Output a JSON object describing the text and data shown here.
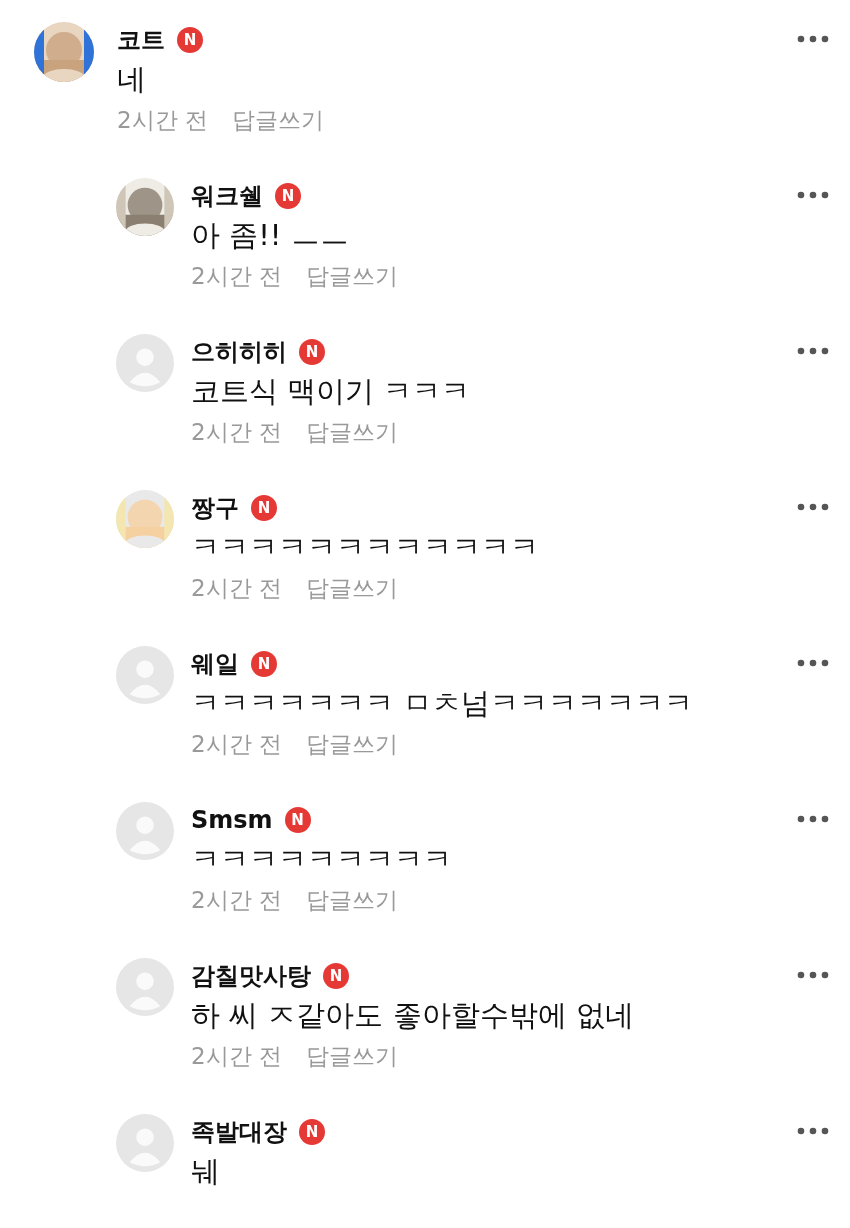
{
  "comments": [
    {
      "name": "코트",
      "badge": "N",
      "text": "네",
      "time": "2시간 전",
      "reply_label": "답글쓰기",
      "children": [
        {
          "name": "워크쉘",
          "badge": "N",
          "text": "아 좀!! ㅡㅡ",
          "time": "2시간 전",
          "reply_label": "답글쓰기"
        },
        {
          "name": "으히히히",
          "badge": "N",
          "avatar": {
            "kind": "default"
          },
          "text": "코트식 맥이기 ㅋㅋㅋ",
          "time": "2시간 전",
          "reply_label": "답글쓰기"
        },
        {
          "name": "짱구",
          "badge": "N",
          "text": "ㅋㅋㅋㅋㅋㅋㅋㅋㅋㅋㅋㅋ",
          "time": "2시간 전",
          "reply_label": "답글쓰기"
        },
        {
          "name": "웨일",
          "badge": "N",
          "avatar": {
            "kind": "default"
          },
          "text": "ㅋㅋㅋㅋㅋㅋㅋ ㅁㅊ넘ㅋㅋㅋㅋㅋㅋㅋ",
          "time": "2시간 전",
          "reply_label": "답글쓰기"
        },
        {
          "name": "Smsm",
          "badge": "N",
          "avatar": {
            "kind": "default"
          },
          "text": "ㅋㅋㅋㅋㅋㅋㅋㅋㅋ",
          "time": "2시간 전",
          "reply_label": "답글쓰기"
        },
        {
          "name": "감칠맛사탕",
          "badge": "N",
          "avatar": {
            "kind": "default"
          },
          "text": "하 씨 ㅈ같아도 좋아할수밖에 없네",
          "time": "2시간 전",
          "reply_label": "답글쓰기"
        },
        {
          "name": "족발대장",
          "badge": "N",
          "avatar": {
            "kind": "default"
          },
          "text": "눼"
        }
      ]
    }
  ]
}
